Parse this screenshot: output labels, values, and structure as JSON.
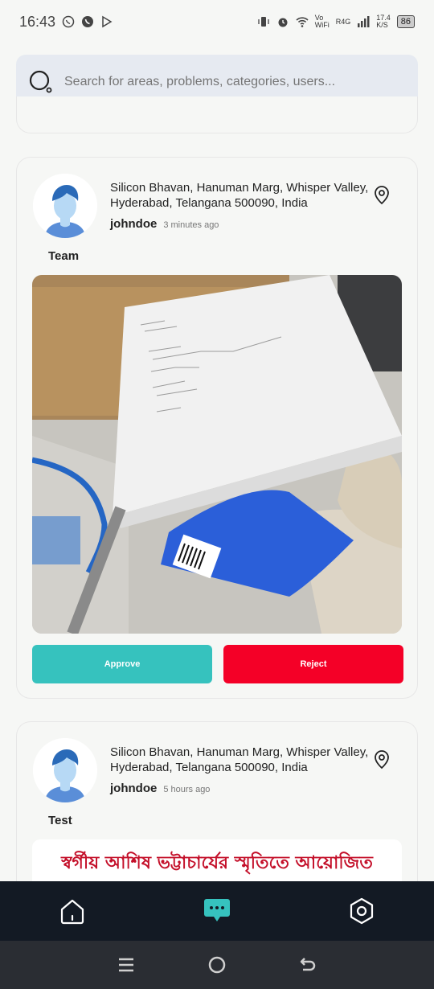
{
  "status_bar": {
    "time": "16:43",
    "wifi_label_top": "Vo",
    "wifi_label_bottom": "WiFi",
    "signal_label": "R4G",
    "speed_top": "17.4",
    "speed_bottom": "K/S",
    "battery": "86"
  },
  "search": {
    "placeholder": "Search for areas, problems, categories, users...",
    "icon": "search-icon"
  },
  "posts": [
    {
      "address": "Silicon Bhavan, Hanuman Marg, Whisper Valley, Hyderabad, Telangana 500090, India",
      "author": "johndoe",
      "time_ago": "3 minutes ago",
      "category": "Team",
      "approve_label": "Approve",
      "reject_label": "Reject"
    },
    {
      "address": "Silicon Bhavan, Hanuman Marg, Whisper Valley, Hyderabad, Telangana 500090, India",
      "author": "johndoe",
      "time_ago": "5 hours ago",
      "category": "Test",
      "banner_text": "স্বর্গীয় আশিষ ভট্টাচার্যের স্মৃতিতে আয়োজিত"
    }
  ],
  "bottom_nav": {
    "items": [
      "home-icon",
      "chat-icon",
      "settings-icon"
    ],
    "active_color": "#36c2be"
  },
  "colors": {
    "approve": "#36c2be",
    "reject": "#f40027",
    "nav_bg": "#131a24"
  }
}
